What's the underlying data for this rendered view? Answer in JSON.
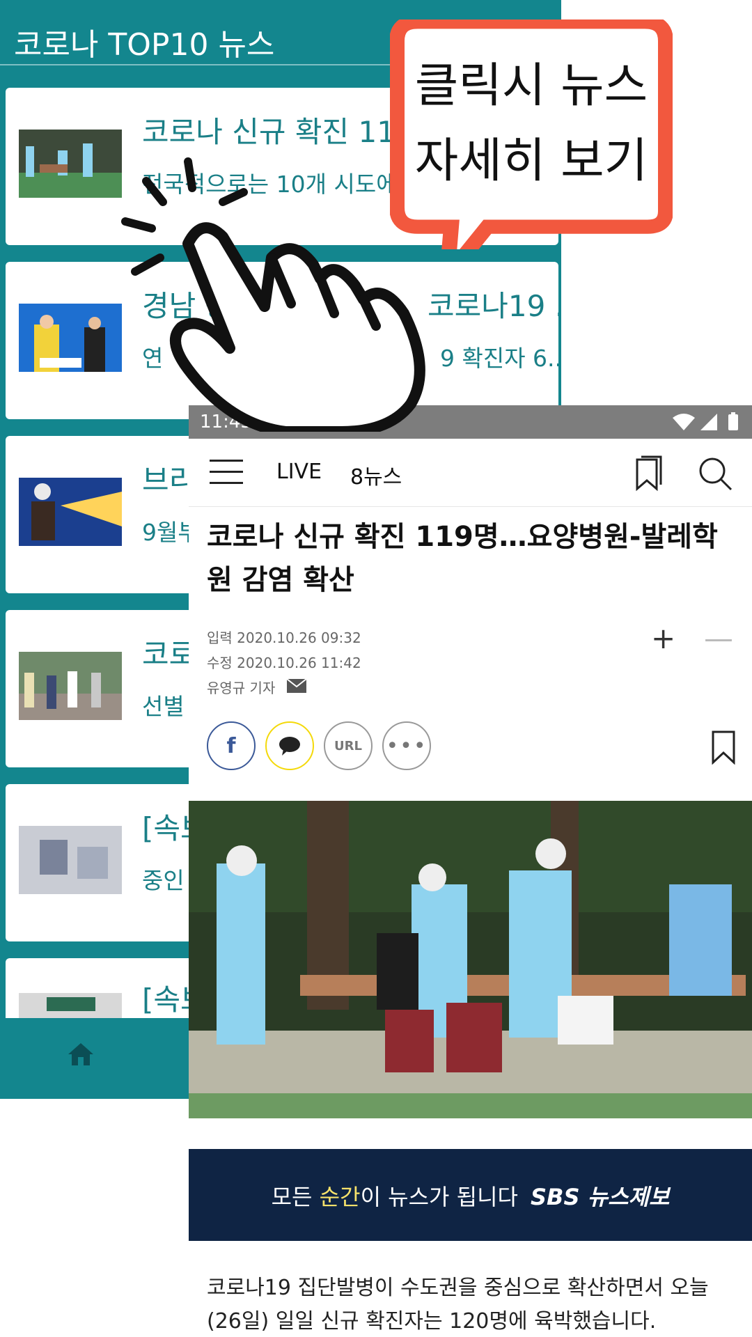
{
  "top10": {
    "title": "코로나 TOP10 뉴스",
    "items": [
      {
        "title": "코로나 신규 확진 119명",
        "subtitle": "전국적으로는 10개 시도에서"
      },
      {
        "title": "경남 공",
        "title_right": "코로나19 ...",
        "subtitle": "연",
        "subtitle_right": "9 확진자 6..."
      },
      {
        "title": "브리",
        "subtitle": "9월부"
      },
      {
        "title": "코로",
        "subtitle": "선별"
      },
      {
        "title": "[속보",
        "subtitle": "중인"
      },
      {
        "title": "[속보",
        "subtitle": ""
      }
    ],
    "home_icon": "home-icon"
  },
  "callout": {
    "line1": "클릭시 뉴스",
    "line2": "자세히 보기",
    "color": "#f2583e"
  },
  "news": {
    "status_time": "11:45",
    "nav": {
      "live": "LIVE",
      "eight_news": "8뉴스"
    },
    "headline": "코로나 신규 확진 119명…요양병원-발레학원 감염 확산",
    "meta_input": "입력 2020.10.26 09:32",
    "meta_edit": "수정 2020.10.26 11:42",
    "reporter": "유영규 기자",
    "zoom_plus": "+",
    "zoom_minus": "—",
    "share": {
      "facebook": "f",
      "url": "URL",
      "more": "•••"
    },
    "banner": {
      "before": "모든 ",
      "highlight": "순간",
      "after": "이 뉴스가 됩니다",
      "brand": "SBS 뉴스제보"
    },
    "body": "코로나19 집단발병이 수도권을 중심으로 확산하면서 오늘(26일) 일일 신규 확진자는 120명에 육박했습니다."
  },
  "colors": {
    "teal": "#13868e",
    "banner_bg": "#0f2444",
    "callout_orange": "#f2583e"
  }
}
